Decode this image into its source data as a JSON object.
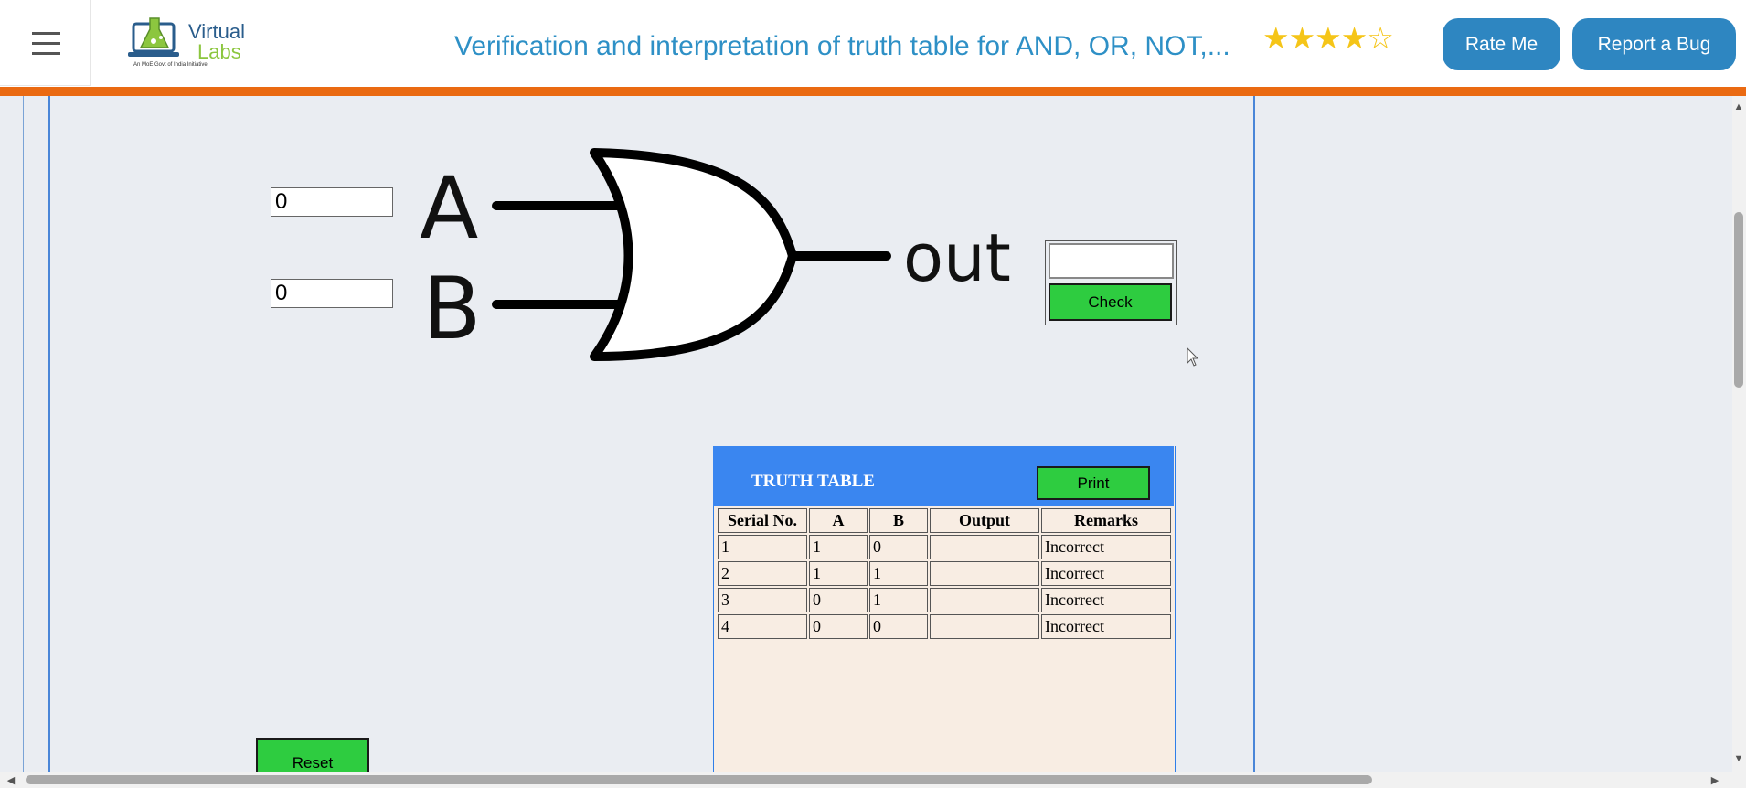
{
  "header": {
    "logo_line1": "Virtual",
    "logo_line2": "Labs",
    "logo_tagline": "An MoE Govt of India Initiative",
    "title": "Verification and interpretation of truth table for AND, OR, NOT,...",
    "rating_filled": 4,
    "rating_max": 5,
    "rating_stars_filled": "★★★★",
    "rating_stars_empty": "☆",
    "rate_button": "Rate Me",
    "bug_button": "Report a Bug",
    "accent_color": "#ea6a12",
    "button_color": "#2e86c1",
    "icons": {
      "menu": "hamburger-menu-icon",
      "logo": "virtual-labs-logo"
    }
  },
  "simulator": {
    "input_a_value": "0",
    "input_b_value": "0",
    "gate": {
      "type": "OR",
      "label_a": "A",
      "label_b": "B",
      "label_out": "out"
    },
    "output_value": "",
    "check_button": "Check",
    "reset_button": "Reset"
  },
  "truth_table": {
    "title": "TRUTH TABLE",
    "print_button": "Print",
    "columns": [
      "Serial No.",
      "A",
      "B",
      "Output",
      "Remarks"
    ],
    "rows": [
      [
        "1",
        "1",
        "0",
        "",
        "Incorrect"
      ],
      [
        "2",
        "1",
        "1",
        "",
        "Incorrect"
      ],
      [
        "3",
        "0",
        "1",
        "",
        "Incorrect"
      ],
      [
        "4",
        "0",
        "0",
        "",
        "Incorrect"
      ]
    ],
    "header_color": "#3a86f0",
    "button_color": "#2ecc40"
  }
}
